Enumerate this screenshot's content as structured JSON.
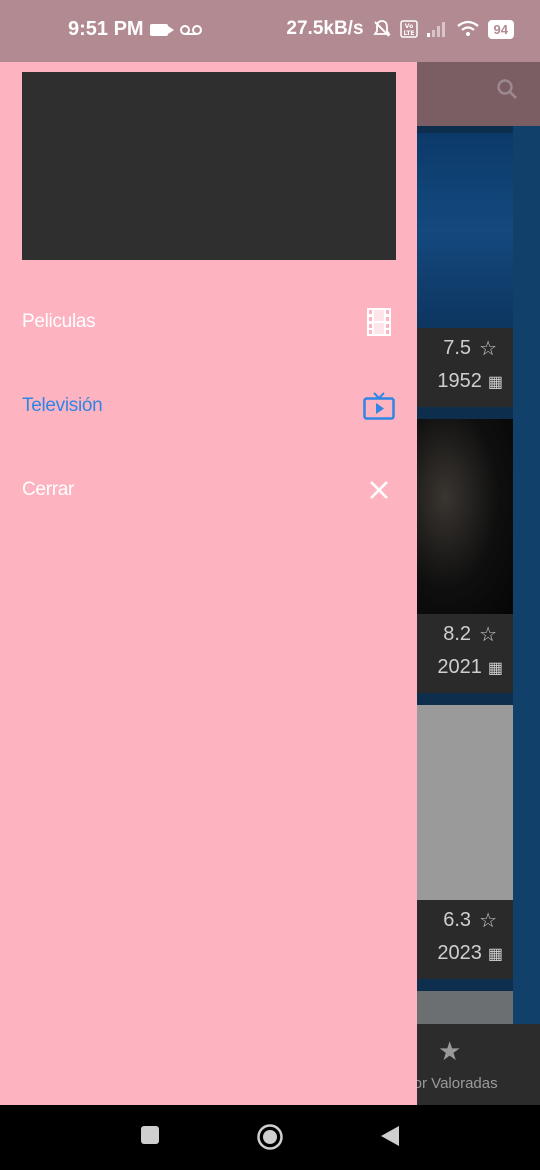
{
  "status_bar": {
    "time": "9:51 PM",
    "net_speed": "27.5kB/s",
    "battery": "94"
  },
  "background": {
    "cards": [
      {
        "rating": "7.5",
        "year": "1952"
      },
      {
        "rating": "8.2",
        "year": "2021"
      },
      {
        "rating": "6.3",
        "year": "2023"
      }
    ],
    "bottom_nav_label": "ejor Valoradas"
  },
  "drawer": {
    "items": [
      {
        "label": "Peliculas",
        "icon": "film-icon",
        "active": false
      },
      {
        "label": "Televisión",
        "icon": "tv-icon",
        "active": true
      },
      {
        "label": "Cerrar",
        "icon": "close-icon",
        "active": false
      }
    ]
  },
  "colors": {
    "drawer_bg": "#feb3c0",
    "active": "#2f86e6",
    "header": "#2f2f2f"
  }
}
